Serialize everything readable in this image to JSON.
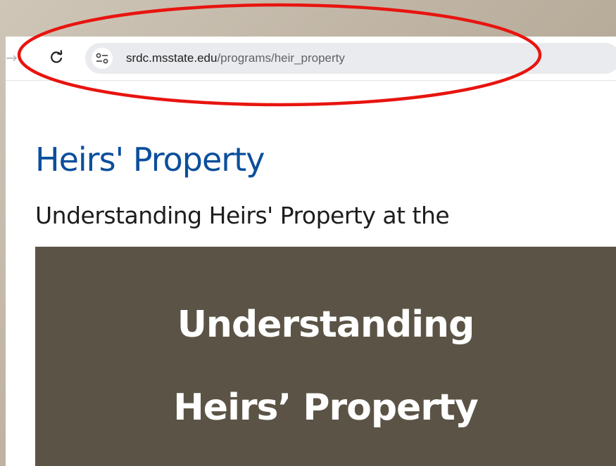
{
  "toolbar": {
    "back_icon": "arrow-left-icon",
    "reload_icon": "reload-icon",
    "site_info_icon": "tune-icon"
  },
  "address_bar": {
    "host": "srdc.msstate.edu",
    "path": "/programs/heir_property"
  },
  "page": {
    "title": "Heirs' Property",
    "subtitle": "Understanding Heirs' Property at the"
  },
  "hero": {
    "line1": "Understanding",
    "line2": "Heirs’ Property",
    "background_color": "#5b5446"
  },
  "colors": {
    "title_blue": "#0b4f9c",
    "annotation_red": "#e8140f"
  }
}
